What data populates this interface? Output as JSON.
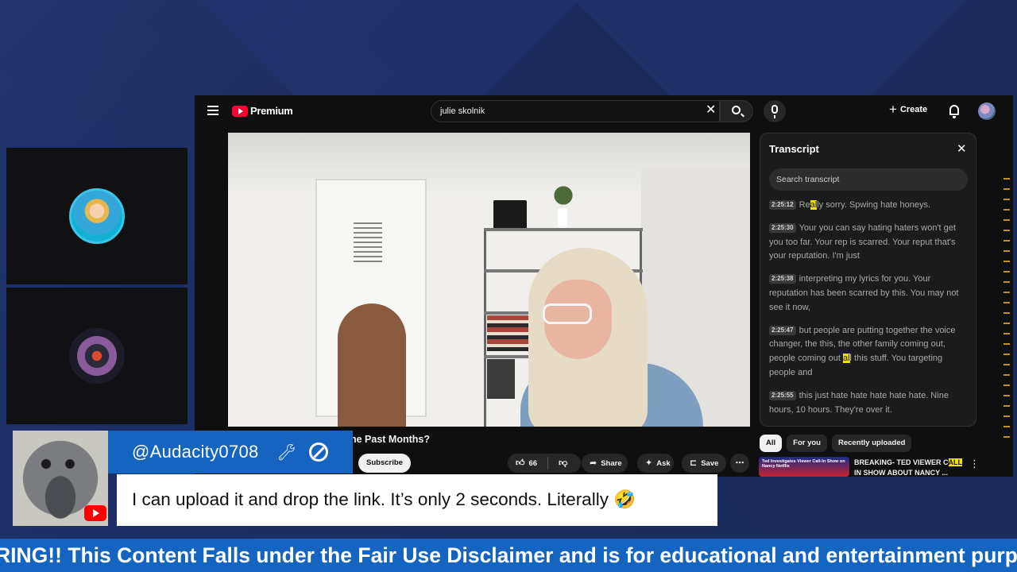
{
  "youtube": {
    "logo_text": "Premium",
    "search_value": "julie skolnik",
    "create_label": "Create",
    "video_title_partial": "he Past Months?",
    "subscribe_label": "Subscribe",
    "like_count": "66",
    "share_label": "Share",
    "ask_label": "Ask",
    "save_label": "Save"
  },
  "transcript": {
    "title": "Transcript",
    "search_placeholder": "Search transcript",
    "entries": [
      {
        "time": "2:25:12",
        "pre": "Re",
        "hl": "al",
        "post": "ly sorry. Spwing hate honeys."
      },
      {
        "time": "2:25:30",
        "text": "Your you can say hating haters won't get you too far. Your rep is scarred. Your reput that's your reputation. I'm just"
      },
      {
        "time": "2:25:38",
        "text": "interpreting my lyrics for you. Your reputation has been scarred by this. You may not see it now,"
      },
      {
        "time": "2:25:47",
        "pre": "but people are putting together the voice changer, the this, the other family coming out, people coming out ",
        "hl": "al",
        "post": "l this stuff. You targeting people and"
      },
      {
        "time": "2:25:55",
        "text": "this just hate hate hate hate hate. Nine hours, 10 hours. They're over it."
      }
    ]
  },
  "chips": [
    "All",
    "For you",
    "Recently uploaded"
  ],
  "recommendation": {
    "thumb_text": "Ted Investigates Viewer Call-In Show on Nancy Netflix",
    "title": "BREAKING- TED VIEWER C",
    "title_hl": "ALL",
    "title_rest": " IN SHOW ABOUT NANCY ..."
  },
  "chat": {
    "username": "@Audacity0708",
    "message": "I can upload it and drop the link. It’s only 2 seconds. Literally 🤣"
  },
  "ticker": {
    "text": "RING!! This Content Falls under the Fair Use Disclaimer and is for educational and entertainment purposes o"
  },
  "colors": {
    "background": "#1a2a5c",
    "chat_blue": "#1565c0",
    "youtube_red": "#ff0033",
    "highlight": "#f2e200"
  },
  "icons": [
    "menu-icon",
    "youtube-logo-icon",
    "close-icon",
    "search-icon",
    "mic-icon",
    "plus-icon",
    "bell-icon",
    "like-icon",
    "dislike-icon",
    "share-icon",
    "ask-icon",
    "save-icon",
    "more-icon",
    "wrench-icon",
    "ban-icon",
    "youtube-badge-icon"
  ]
}
